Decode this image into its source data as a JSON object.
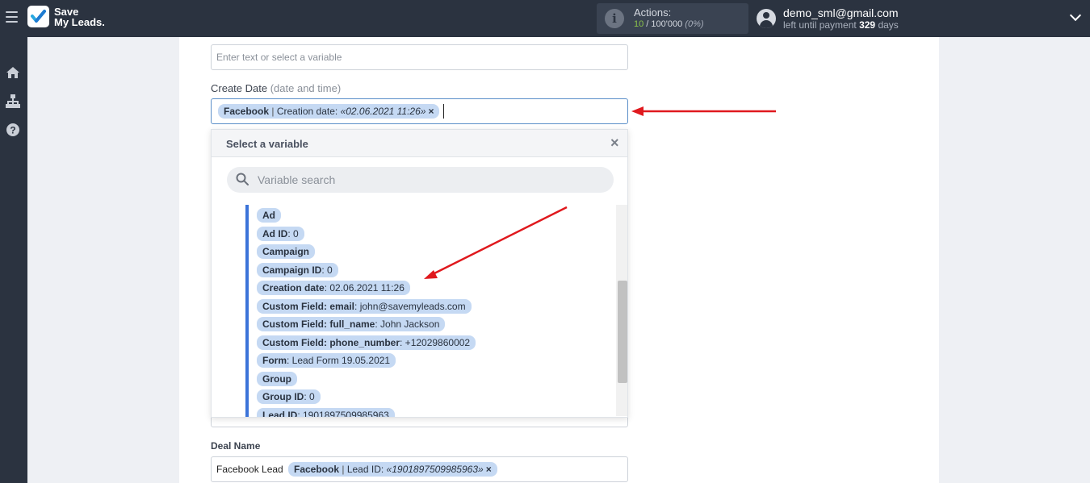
{
  "app": {
    "logo_line1": "Save",
    "logo_line2": "My Leads."
  },
  "header": {
    "actions_label": "Actions:",
    "actions_used": "10",
    "actions_total": "100'000",
    "actions_percent": "(0%)",
    "user_email": "demo_sml@gmail.com",
    "payment_prefix": "left until payment",
    "payment_days": "329",
    "payment_suffix": "days"
  },
  "sidebar": {
    "items": [
      {
        "icon": "home-icon"
      },
      {
        "icon": "sitemap-icon"
      },
      {
        "icon": "help-icon"
      }
    ]
  },
  "form": {
    "top_field_placeholder": "Enter text or select a variable",
    "create_date_label": "Create Date",
    "create_date_hint": "(date and time)",
    "create_date_tag": {
      "source": "Facebook",
      "separator": "|",
      "field": "Creation date:",
      "value": "«02.06.2021 11:26»",
      "remove": "×"
    },
    "deal_name_label": "Deal Name",
    "deal_name_prefix": "Facebook Lead",
    "deal_name_tag": {
      "source": "Facebook",
      "separator": "|",
      "field": "Lead ID:",
      "value": "«1901897509985963»",
      "remove": "×"
    }
  },
  "dropdown": {
    "title": "Select a variable",
    "close": "×",
    "search_placeholder": "Variable search",
    "items": [
      {
        "name": "Ad",
        "value": ""
      },
      {
        "name": "Ad ID",
        "value": ": 0"
      },
      {
        "name": "Campaign",
        "value": ""
      },
      {
        "name": "Campaign ID",
        "value": ": 0"
      },
      {
        "name": "Creation date",
        "value": ": 02.06.2021 11:26"
      },
      {
        "name": "Custom Field: email",
        "value": ": john@savemyleads.com"
      },
      {
        "name": "Custom Field: full_name",
        "value": ": John Jackson"
      },
      {
        "name": "Custom Field: phone_number",
        "value": ": +12029860002"
      },
      {
        "name": "Form",
        "value": ": Lead Form 19.05.2021"
      },
      {
        "name": "Group",
        "value": ""
      },
      {
        "name": "Group ID",
        "value": ": 0"
      },
      {
        "name": "Lead ID",
        "value": ": 1901897509985963"
      }
    ]
  },
  "colors": {
    "topbar": "#2b3340",
    "tag_bg": "#c5d9f3",
    "accent_border": "#3b73d9",
    "annotation_arrow": "#e0191e",
    "actions_used": "#8bc34a"
  }
}
